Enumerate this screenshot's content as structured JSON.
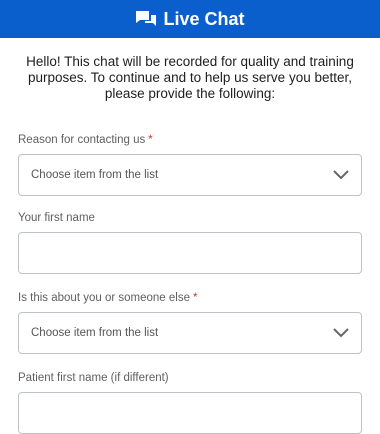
{
  "header": {
    "title": "Live Chat",
    "icon": "chat-bubbles-icon"
  },
  "intro": {
    "text": "Hello! This chat will be recorded for quality and training purposes. To continue and to help us serve you better, please provide the following:"
  },
  "form": {
    "reason": {
      "label": "Reason for contacting us",
      "required_mark": "*",
      "placeholder": "Choose item from the list"
    },
    "first_name": {
      "label": "Your first name",
      "value": ""
    },
    "about": {
      "label": "Is this about you or someone else",
      "required_mark": "*",
      "placeholder": "Choose item from the list"
    },
    "patient_first_name": {
      "label": "Patient first name (if different)",
      "value": ""
    }
  },
  "colors": {
    "header_bg": "#0a5fcc",
    "required": "#c0392b"
  }
}
